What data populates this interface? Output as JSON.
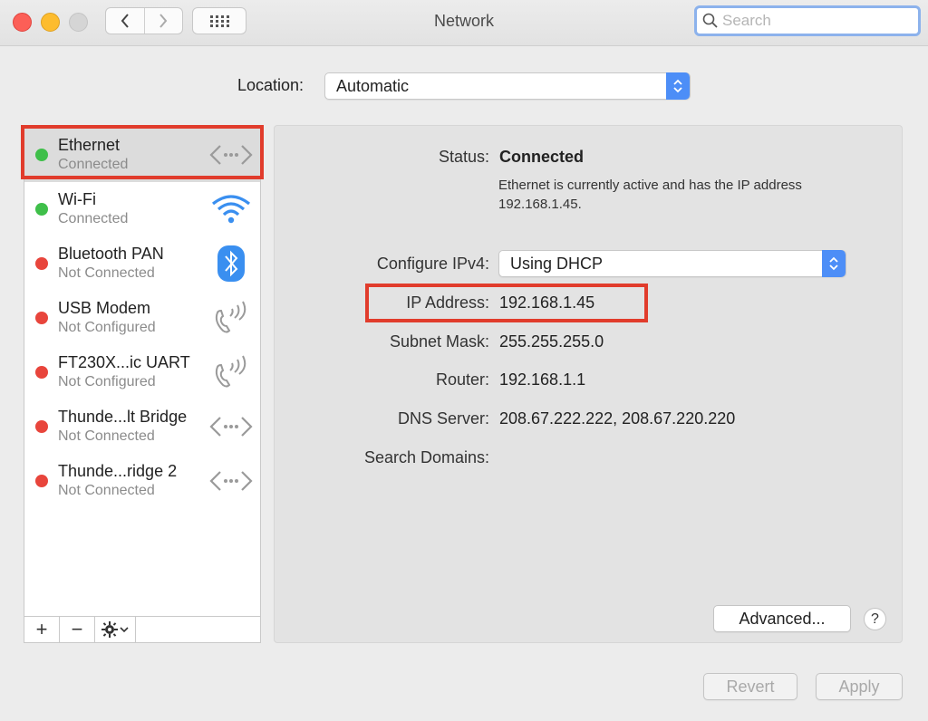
{
  "window": {
    "title": "Network",
    "search_placeholder": "Search"
  },
  "location": {
    "label": "Location:",
    "value": "Automatic"
  },
  "services": [
    {
      "name": "Ethernet",
      "status": "Connected",
      "state": "connected",
      "icon": "ethernet-arrows-icon"
    },
    {
      "name": "Wi-Fi",
      "status": "Connected",
      "state": "connected",
      "icon": "wifi-icon"
    },
    {
      "name": "Bluetooth PAN",
      "status": "Not Connected",
      "state": "disconnected",
      "icon": "bluetooth-icon"
    },
    {
      "name": "USB Modem",
      "status": "Not Configured",
      "state": "disconnected",
      "icon": "phone-icon"
    },
    {
      "name": "FT230X...ic UART",
      "status": "Not Configured",
      "state": "disconnected",
      "icon": "phone-icon"
    },
    {
      "name": "Thunde...lt Bridge",
      "status": "Not Connected",
      "state": "disconnected",
      "icon": "ethernet-arrows-icon"
    },
    {
      "name": "Thunde...ridge 2",
      "status": "Not Connected",
      "state": "disconnected",
      "icon": "ethernet-arrows-icon"
    }
  ],
  "sidebar_buttons": {
    "add": "+",
    "remove": "−"
  },
  "details": {
    "status_label": "Status:",
    "status_value": "Connected",
    "description": "Ethernet is currently active and has the IP address 192.168.1.45.",
    "configure_label": "Configure IPv4:",
    "configure_value": "Using DHCP",
    "ip_label": "IP Address:",
    "ip_value": "192.168.1.45",
    "subnet_label": "Subnet Mask:",
    "subnet_value": "255.255.255.0",
    "router_label": "Router:",
    "router_value": "192.168.1.1",
    "dns_label": "DNS Server:",
    "dns_value": "208.67.222.222, 208.67.220.220",
    "search_domains_label": "Search Domains:",
    "search_domains_value": ""
  },
  "buttons": {
    "advanced": "Advanced...",
    "help": "?",
    "revert": "Revert",
    "apply": "Apply"
  },
  "colors": {
    "status_connected": "#3fbf4a",
    "status_disconnected": "#e8453c",
    "highlight": "#e13c2c",
    "accent": "#4d8ef7"
  }
}
